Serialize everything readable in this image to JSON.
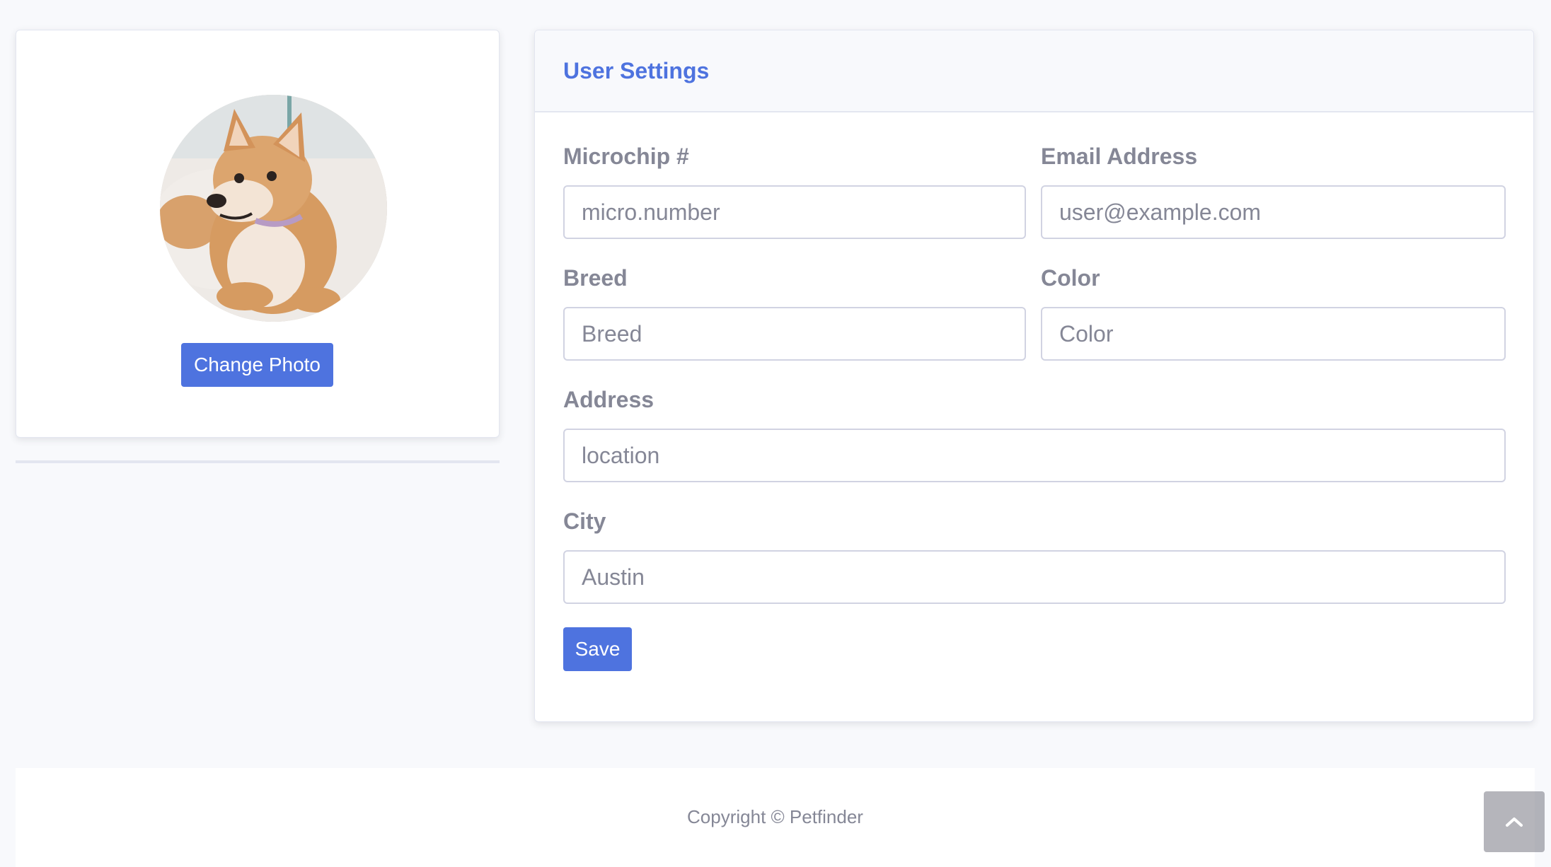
{
  "profile": {
    "avatar_alt": "Shiba Inu dog photo",
    "change_photo_label": "Change Photo"
  },
  "settings": {
    "title": "User Settings",
    "microchip": {
      "label": "Microchip #",
      "placeholder": "micro.number"
    },
    "email": {
      "label": "Email Address",
      "placeholder": "user@example.com"
    },
    "breed": {
      "label": "Breed",
      "placeholder": "Breed"
    },
    "color": {
      "label": "Color",
      "placeholder": "Color"
    },
    "address": {
      "label": "Address",
      "placeholder": "location"
    },
    "city": {
      "label": "City",
      "placeholder": "Austin"
    },
    "save_label": "Save"
  },
  "footer": {
    "copyright": "Copyright © Petfinder"
  },
  "icons": {
    "scroll_top": "chevron-up-icon"
  },
  "colors": {
    "primary": "#4e73df",
    "text_muted": "#858796",
    "page_bg": "#f8f9fc"
  }
}
